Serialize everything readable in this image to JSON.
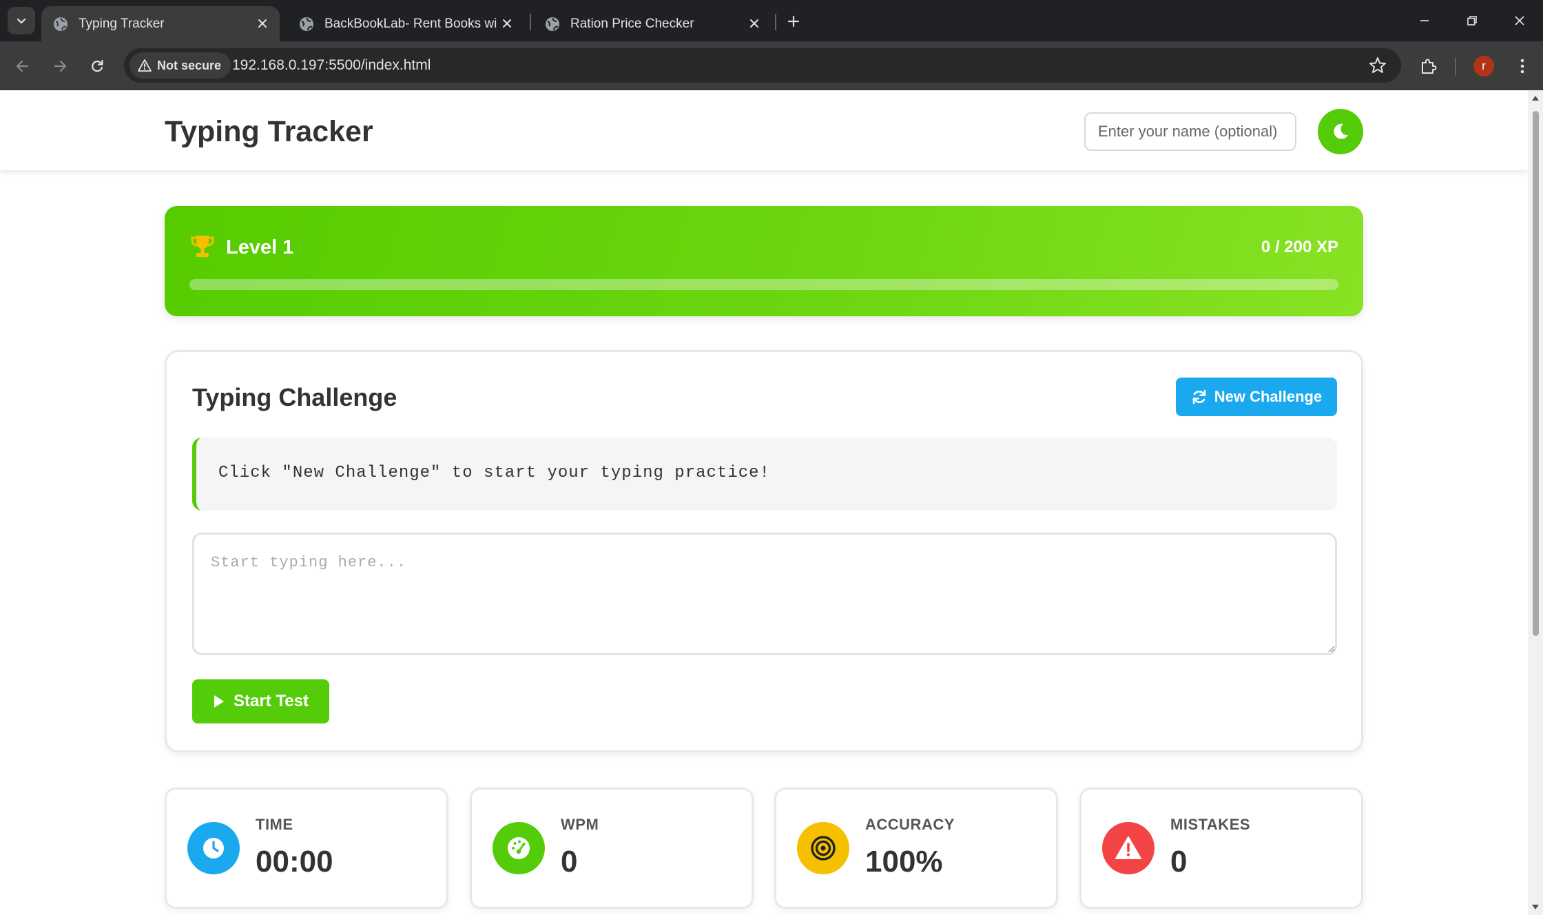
{
  "browser": {
    "tabs": [
      {
        "title": "Typing Tracker",
        "active": true
      },
      {
        "title": "BackBookLab- Rent Books with",
        "active": false
      },
      {
        "title": "Ration Price Checker",
        "active": false
      }
    ],
    "security_label": "Not secure",
    "url": "192.168.0.197:5500/index.html",
    "profile_initial": "r"
  },
  "header": {
    "title": "Typing Tracker",
    "name_placeholder": "Enter your name (optional)",
    "theme_icon": "moon-icon"
  },
  "level": {
    "label": "Level 1",
    "xp_text": "0 / 200 XP",
    "xp_progress": 0,
    "icon": "trophy-icon"
  },
  "challenge": {
    "title": "Typing Challenge",
    "new_button": "New Challenge",
    "prompt": "Click \"New Challenge\" to start your typing practice!",
    "input_placeholder": "Start typing here...",
    "start_button": "Start Test"
  },
  "stats": [
    {
      "label": "TIME",
      "value": "00:00",
      "icon": "clock-icon",
      "color": "#1aa9ee"
    },
    {
      "label": "WPM",
      "value": "0",
      "icon": "speedometer-icon",
      "color": "#55cc0a"
    },
    {
      "label": "ACCURACY",
      "value": "100%",
      "icon": "target-icon",
      "color": "#f5c000"
    },
    {
      "label": "MISTAKES",
      "value": "0",
      "icon": "warning-icon",
      "color": "#f24444"
    }
  ],
  "colors": {
    "accent_green": "#55cc0a",
    "accent_blue": "#1aa9ee",
    "text_dark": "#333333"
  }
}
